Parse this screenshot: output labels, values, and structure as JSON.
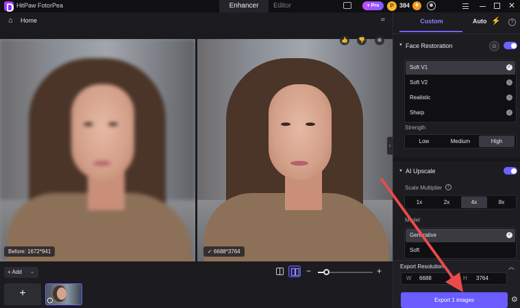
{
  "app": {
    "title": "HitPaw FotorPea",
    "nav": {
      "enhancer": "Enhancer",
      "editor": "Editor"
    },
    "pro_badge": "+ Pro",
    "coin_symbol": "P",
    "coins": "384",
    "coin_plus": "+",
    "close": "✕"
  },
  "subheader": {
    "home": "Home",
    "home_icon": "⌂",
    "crop_icon": "⌗"
  },
  "preview": {
    "before_caption": "Before: 1672*941",
    "after_caption": "✓  6688*3764",
    "like_icon": "👍",
    "dislike_icon": "👎",
    "zoom_icon": "⊕",
    "collapse_icon": "‹"
  },
  "bottom": {
    "add_label": "+ Add",
    "add_chevron": "⌄",
    "zoom_minus": "−",
    "zoom_plus": "+",
    "zoom_level": 0.15,
    "add_tile": "+",
    "thumb_info": "i"
  },
  "panel": {
    "tabs": {
      "custom": "Custom",
      "auto": "Auto",
      "bolt": "⚡",
      "help": "?"
    },
    "face_restoration": {
      "title": "Face Restoration",
      "caret": "▼",
      "face_icon": "☺",
      "enabled": true,
      "models": [
        {
          "label": "Soft V1",
          "icon": "✓",
          "selected": true
        },
        {
          "label": "Soft V2",
          "icon": "↓",
          "selected": false
        },
        {
          "label": "Realistic",
          "icon": "↓",
          "selected": false
        },
        {
          "label": "Sharp",
          "icon": "↓",
          "selected": false
        }
      ],
      "strength_label": "Strength",
      "strength": [
        "Low",
        "Medium",
        "High"
      ],
      "strength_selected": "High"
    },
    "ai_upscale": {
      "title": "AI Upscale",
      "caret": "▼",
      "enabled": true,
      "scale_label": "Scale Multiplier",
      "scale_info": "i",
      "scales": [
        "1x",
        "2x",
        "4x",
        "8x"
      ],
      "scale_selected": "4x",
      "model_label": "Model",
      "models": [
        {
          "label": "Generative",
          "icon": "✓",
          "selected": true
        },
        {
          "label": "Soft",
          "icon": "",
          "selected": false
        }
      ]
    },
    "export": {
      "resolution_label": "Export Resolution",
      "chevron": "︿",
      "width_key": "W",
      "width": "6688",
      "height_key": "H",
      "height": "3764",
      "button": "Export 1 images",
      "settings_icon": "⚙"
    }
  },
  "colors": {
    "accent": "#6a5cff",
    "annotation_arrow": "#ec4a4a"
  }
}
